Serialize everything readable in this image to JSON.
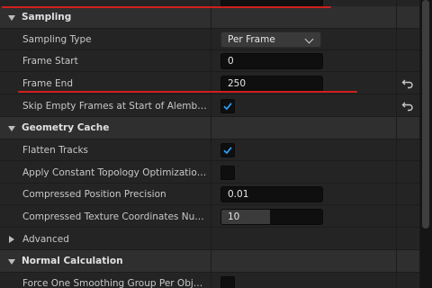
{
  "colors": {
    "accent_check": "#2aa3ff",
    "highlight_underline": "#d0201c"
  },
  "top_partial": {
    "label": "",
    "value": ""
  },
  "sections": {
    "sampling": {
      "title": "Sampling",
      "sampling_type": {
        "label": "Sampling Type",
        "value": "Per Frame"
      },
      "frame_start": {
        "label": "Frame Start",
        "value": "0"
      },
      "frame_end": {
        "label": "Frame End",
        "value": "250"
      },
      "skip_empty": {
        "label": "Skip Empty Frames at Start of Alembic Seq...",
        "checked": true
      }
    },
    "geometry_cache": {
      "title": "Geometry Cache",
      "flatten_tracks": {
        "label": "Flatten Tracks",
        "checked": true
      },
      "constant_topology": {
        "label": "Apply Constant Topology Optimizations",
        "checked": false
      },
      "position_precision": {
        "label": "Compressed Position Precision",
        "value": "0.01"
      },
      "texcoord_bits": {
        "label": "Compressed Texture Coordinates Number...",
        "value": "10",
        "slider_fraction": 0.48
      }
    },
    "advanced": {
      "title": "Advanced",
      "expanded": false
    },
    "normal_calculation": {
      "title": "Normal Calculation",
      "smoothing_group": {
        "label": "Force One Smoothing Group Per Object",
        "checked": false
      }
    }
  },
  "icons": {
    "reset": "reset-arrow-icon",
    "expand": "caret-icon",
    "dropdown": "chevron-down-icon",
    "check": "checkmark-icon"
  }
}
